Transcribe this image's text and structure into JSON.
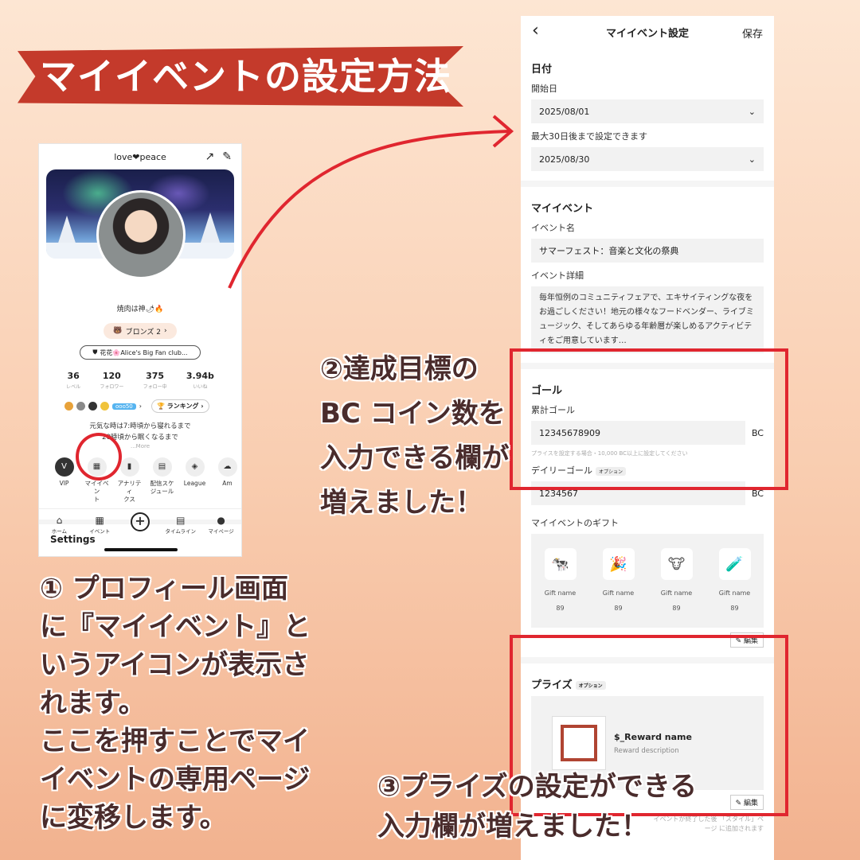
{
  "title": "マイイベントの設定方法",
  "colors": {
    "accent_red": "#e0262f",
    "banner": "#c43a2b",
    "text_dark": "#4a2c2c"
  },
  "left_phone": {
    "header_title": "love❤peace",
    "header_icons": [
      "share-icon",
      "edit-icon"
    ],
    "username": "焼肉は神🌶🔥",
    "rank_badge": "ブロンズ 2",
    "fan_club": "花花🌸Alice's Big Fan club...",
    "stats": [
      {
        "value": "36",
        "label": "レベル"
      },
      {
        "value": "120",
        "label": "フォロワー"
      },
      {
        "value": "375",
        "label": "フォロー中"
      },
      {
        "value": "3.94b",
        "label": "いいね"
      }
    ],
    "badge_chip": "ooo50",
    "ranking_label": "ランキング",
    "bio_line1": "元気な時は7:時頃から寝れるまで",
    "bio_line2": "20時頃から眠くなるまで",
    "more": "...More",
    "menu": [
      {
        "icon": "V",
        "label": "VIP"
      },
      {
        "icon": "▦",
        "label": "マイイベン\nト"
      },
      {
        "icon": "▮",
        "label": "アナリティ\nクス"
      },
      {
        "icon": "▤",
        "label": "配信スケ\nジュール"
      },
      {
        "icon": "◈",
        "label": "League"
      },
      {
        "icon": "☁",
        "label": "Am"
      }
    ],
    "settings": "Settings",
    "tabs": [
      {
        "icon": "⌂",
        "label": "ホーム"
      },
      {
        "icon": "▦",
        "label": "イベント"
      },
      {
        "icon": "+",
        "label": ""
      },
      {
        "icon": "▤",
        "label": "タイムライン"
      },
      {
        "icon": "●",
        "label": "マイページ"
      }
    ]
  },
  "right_phone": {
    "back": "‹",
    "title": "マイイベント設定",
    "save": "保存",
    "date_section": "日付",
    "start_label": "開始日",
    "start_value": "2025/08/01",
    "end_label": "最大30日後まで設定できます",
    "end_value": "2025/08/30",
    "event_section": "マイイベント",
    "name_label": "イベント名",
    "name_value": "サマーフェスト：音楽と文化の祭典",
    "detail_label": "イベント詳細",
    "detail_value": "毎年恒例のコミュニティフェアで、エキサイティングな夜をお過ごしください！地元の様々なフードベンダー、ライブミュージック、そしてあらゆる年齢層が楽しめるアクティビティをご用意しています…",
    "goal_section": "ゴール",
    "total_goal_label": "累計ゴール",
    "total_goal_value": "12345678909",
    "unit": "BC",
    "goal_hint": "プライスを設定する場合・10,000 BC以上に設定してください",
    "daily_goal_label": "デイリーゴール",
    "option_tag": "オプション",
    "daily_goal_value": "1234567",
    "gift_section": "マイイベントのギフト",
    "gifts": [
      {
        "icon": "🐄",
        "name": "Gift name",
        "price": "89"
      },
      {
        "icon": "🎉",
        "name": "Gift name",
        "price": "89"
      },
      {
        "icon": "🐮",
        "name": "Gift name",
        "price": "89"
      },
      {
        "icon": "🧪",
        "name": "Gift name",
        "price": "89"
      }
    ],
    "edit_label": "編集",
    "prize_section": "プライズ",
    "prize_name": "$_Reward name",
    "prize_desc": "Reward description",
    "prize_note": "イベントが終了した後 「スタイル」ページ に追加されます"
  },
  "captions": {
    "c1": [
      "① プロフィール画面",
      "に『マイイベント』と",
      "いうアイコンが表示さ",
      "れます。",
      "ここを押すことでマイ",
      "イベントの専用ページ",
      "に変移します。"
    ],
    "c2": [
      "②達成目標の",
      "BC コイン数を",
      "入力できる欄が",
      "増えました！"
    ],
    "c3": [
      "③プライズの設定ができる",
      "入力欄が増えました！"
    ]
  }
}
